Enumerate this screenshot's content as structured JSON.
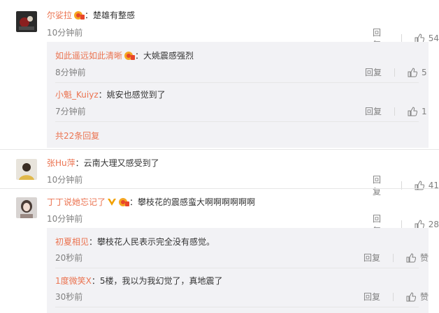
{
  "comments": [
    {
      "user": "尔娑拉",
      "text": "：楚雄有整感",
      "time": "10分钟前",
      "reply": "回复",
      "likes": "54",
      "replies": [
        {
          "user": "如此遥远如此清晰",
          "text": "：大姚震感强烈",
          "time": "8分钟前",
          "reply": "回复",
          "likes": "5"
        },
        {
          "user": "小魁_Kuiyz",
          "text": "：姚安也感觉到了",
          "time": "7分钟前",
          "reply": "回复",
          "likes": "1"
        }
      ],
      "more": "共22条回复"
    },
    {
      "user": "张Hu萍",
      "text": "：云南大理又感受到了",
      "time": "10分钟前",
      "reply": "回复",
      "likes": "41"
    },
    {
      "user": "丁丁说她忘记了",
      "text": "：攀枝花的震感蛮大啊啊啊啊啊啊",
      "time": "10分钟前",
      "reply": "回复",
      "likes": "28",
      "replies": [
        {
          "user": "初夏相见",
          "text": "：攀枝花人民表示完全没有感觉。",
          "time": "20秒前",
          "reply": "回复",
          "likes": "赞"
        },
        {
          "user": "1度微笑X",
          "text": "：5楼，我以为我幻觉了，真地震了",
          "time": "30秒前",
          "reply": "回复",
          "likes": "赞"
        }
      ]
    }
  ]
}
